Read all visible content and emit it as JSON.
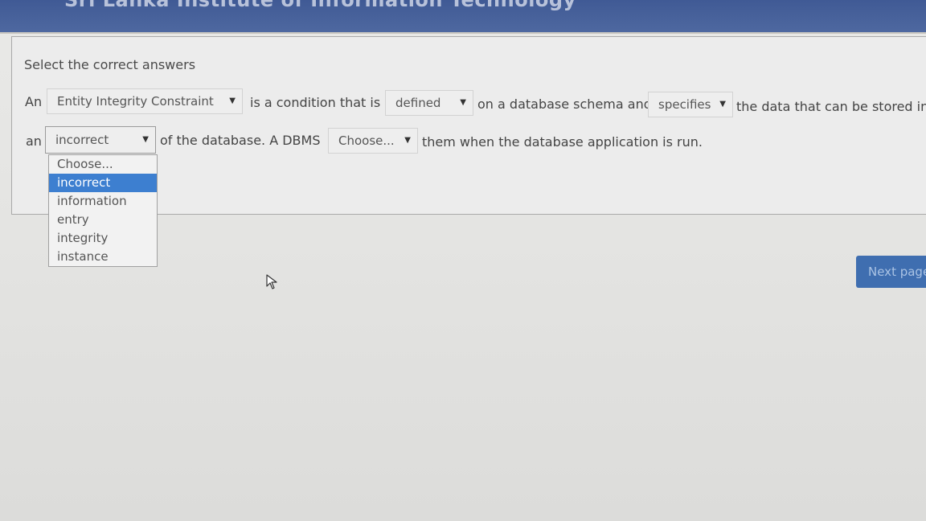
{
  "header": {
    "title": "Sri Lanka Institute of Information Technology"
  },
  "question": {
    "prompt": "Select the correct answers",
    "line1": {
      "t1": "An",
      "t2": "is a condition that is",
      "t3": "on a database schema and",
      "t4": "the data that can be stored in"
    },
    "line2": {
      "t1": "an",
      "t2": "of the database. A DBMS",
      "t3": "them when the database application is run."
    },
    "selects": {
      "s1": "Entity Integrity Constraint",
      "s2": "defined",
      "s3": "specifies",
      "s4": "incorrect",
      "s5": "Choose..."
    },
    "caret_icon": "chevron-down-icon",
    "dropdown": {
      "options": [
        "Choose...",
        "incorrect",
        "information",
        "entry",
        "integrity",
        "instance"
      ],
      "selected_index": 1
    }
  },
  "footer": {
    "next_label": "Next page"
  },
  "colors": {
    "header_bg": "#4a639c",
    "selected_option": "#3d7fd0",
    "next_button": "#3f6eb0"
  }
}
